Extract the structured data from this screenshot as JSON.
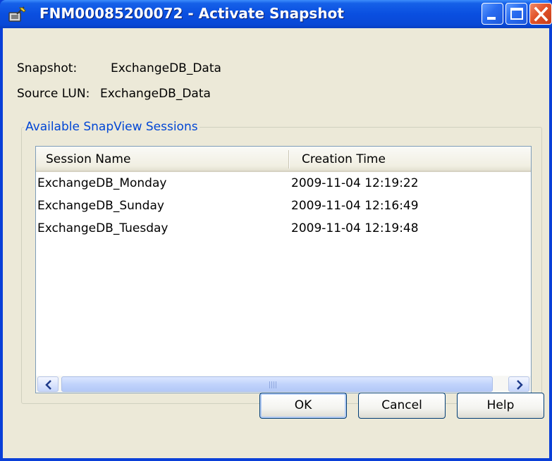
{
  "window": {
    "title": "FNM00085200072 - Activate Snapshot",
    "controls": [
      "minimize",
      "maximize",
      "close"
    ]
  },
  "info": {
    "snapshot_label": "Snapshot:",
    "snapshot_value": "ExchangeDB_Data",
    "source_lun_label": "Source LUN:",
    "source_lun_value": "ExchangeDB_Data"
  },
  "sessions": {
    "group_label": "Available SnapView Sessions",
    "columns": [
      "Session Name",
      "Creation Time"
    ],
    "rows": [
      {
        "name": "ExchangeDB_Monday",
        "time": "2009-11-04 12:19:22"
      },
      {
        "name": "ExchangeDB_Sunday",
        "time": "2009-11-04 12:16:49"
      },
      {
        "name": "ExchangeDB_Tuesday",
        "time": "2009-11-04 12:19:48"
      }
    ]
  },
  "buttons": {
    "ok": "OK",
    "cancel": "Cancel",
    "help": "Help"
  },
  "colors": {
    "titlebar": "#0a4fe0",
    "client_bg": "#ece9d8",
    "group_label": "#0046d5",
    "close_button": "#e2532a"
  }
}
